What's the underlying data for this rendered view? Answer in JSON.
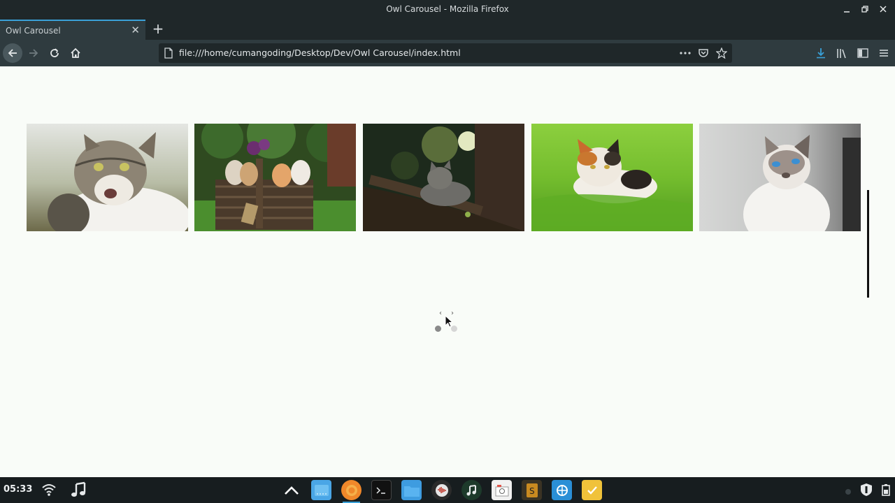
{
  "window": {
    "title": "Owl Carousel - Mozilla Firefox"
  },
  "tab": {
    "title": "Owl Carousel"
  },
  "urlbar": {
    "url": "file:///home/cumangoding/Desktop/Dev/Owl Carousel/index.html"
  },
  "carousel": {
    "slides": [
      {
        "subject": "tabby cat with mouth open"
      },
      {
        "subject": "kittens in a wicker basket"
      },
      {
        "subject": "grey cat on a tree branch"
      },
      {
        "subject": "calico cat lying in green grass"
      },
      {
        "subject": "white cat with blue eyes"
      }
    ],
    "prev_label": "‹",
    "next_label": "›",
    "dots": 2,
    "active_dot": 0
  },
  "taskbar": {
    "clock": "05:33"
  },
  "colors": {
    "accent": "#3aa1d8",
    "chrome_dark": "#1f2729",
    "chrome": "#2f3b3f",
    "page_bg": "#f9fcf8"
  }
}
